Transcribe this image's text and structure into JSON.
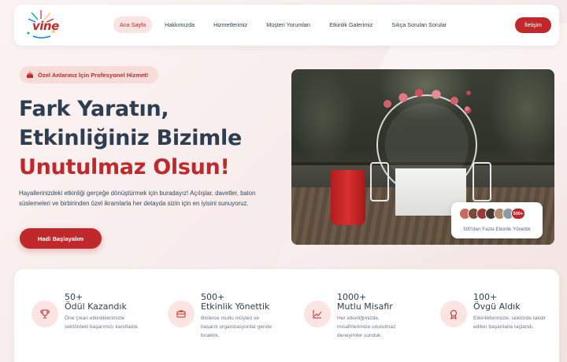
{
  "colors": {
    "accent": "#c0292b",
    "accent_light": "#fbe4e2",
    "heading": "#2c3e50"
  },
  "logo": {
    "text": "vine",
    "icon": "confetti-logo-icon"
  },
  "nav": {
    "links": [
      "Ana Sayfa",
      "Hakkımızda",
      "Hizmetlerimiz",
      "Müşteri Yorumları",
      "Etkinlik Galerimiz",
      "Sıkça Sorulan Sorular"
    ],
    "active": "Ana Sayfa",
    "contact_label": "İletişim"
  },
  "hero": {
    "badge": "Özel Anlarınız İçin Profesyonel Hizmet!",
    "badge_icon": "cake-icon",
    "title_line1": "Fark Yaratın,",
    "title_line2": "Etkinliğiniz Bizimle",
    "title_line3": "Unutulmaz Olsun!",
    "description": "Hayallerinizdeki etkinliği gerçeğe dönüştürmek için buradayız! Açılışlar, davetler, balon süslemeleri ve birbirinden özel ikramlarla her detayda sizin için en iyisini sunuyoruz.",
    "cta_label": "Hadi Başlayalım",
    "image_alt": "Göl kenarında iskele üzerinde çiçekli yuvarlak süsleme ve kırmızı örtülü masa",
    "stat_card": {
      "count": "500+",
      "text": "500'den Fazla Etkinlik Yönettik"
    }
  },
  "stats": [
    {
      "number": "50+",
      "label": "Ödül Kazandık",
      "desc": "Öne çıkan etkinliklerimizle sektördeki başarımızı kanıtladık.",
      "icon": "trophy-icon"
    },
    {
      "number": "500+",
      "label": "Etkinlik Yönettik",
      "desc": "Binlerce mutlu müşteri ve başarılı organizasyonlar geride bıraktık.",
      "icon": "briefcase-icon"
    },
    {
      "number": "1000+",
      "label": "Mutlu Misafir",
      "desc": "Her etkinliğimizde, misafirlerimize unutulmaz deneyimler sunduk.",
      "icon": "chart-line-icon"
    },
    {
      "number": "100+",
      "label": "Övgü Aldık",
      "desc": "Etkinliklerimizle, sektörde takdir edilen başarılarla taçlandı.",
      "icon": "medal-icon"
    }
  ]
}
